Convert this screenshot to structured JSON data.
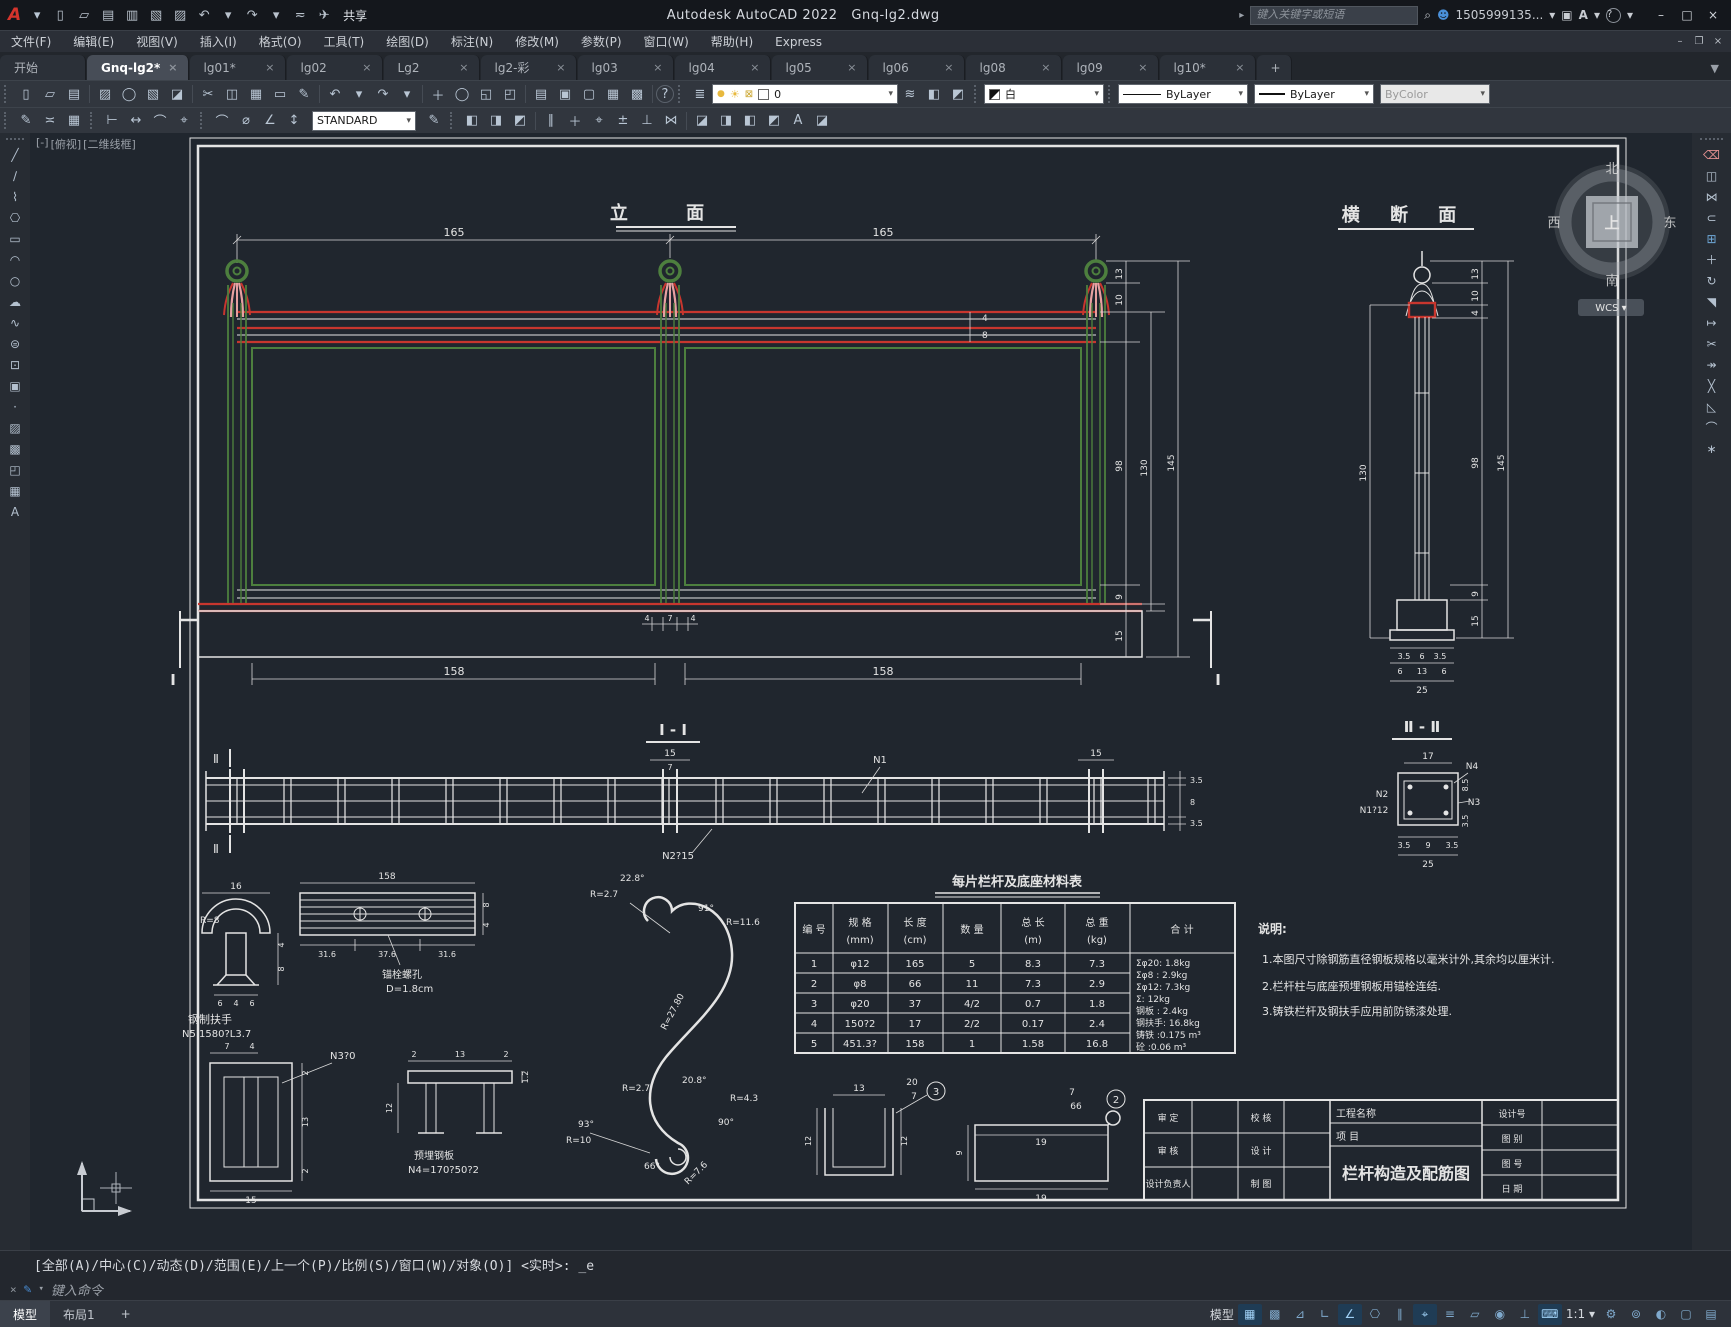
{
  "titlebar": {
    "app_title": "Autodesk AutoCAD 2022",
    "doc_title": "Gnq-lg2.dwg",
    "share_label": "共享",
    "search_placeholder": "键入关键字或短语",
    "account_label": "1505999135...",
    "quick_access_tools": [
      "new",
      "open",
      "save",
      "save-as",
      "plot",
      "print",
      "undo",
      "redo",
      "workspace-dropdown",
      "share"
    ]
  },
  "menubar": {
    "items": [
      "文件(F)",
      "编辑(E)",
      "视图(V)",
      "插入(I)",
      "格式(O)",
      "工具(T)",
      "绘图(D)",
      "标注(N)",
      "修改(M)",
      "参数(P)",
      "窗口(W)",
      "帮助(H)",
      "Express"
    ]
  },
  "file_tabs": {
    "tabs": [
      {
        "label": "开始"
      },
      {
        "label": "Gnq-lg2*"
      },
      {
        "label": "lg01*"
      },
      {
        "label": "lg02"
      },
      {
        "label": "Lg2"
      },
      {
        "label": "lg2-彩"
      },
      {
        "label": "lg03"
      },
      {
        "label": "lg04"
      },
      {
        "label": "lg05"
      },
      {
        "label": "lg06"
      },
      {
        "label": "lg08"
      },
      {
        "label": "lg09"
      },
      {
        "label": "lg10*"
      },
      {
        "label": "+"
      }
    ],
    "active_tab": "Gnq-lg2*",
    "close_glyph": "×"
  },
  "toolbars": {
    "layer_value": "0",
    "color_value": "白",
    "linetype_value": "ByLayer",
    "lineweight_value": "ByLayer",
    "plotstyle_value": "ByColor",
    "style_value": "STANDARD",
    "left_tools": [
      "line",
      "construction-line",
      "polyline",
      "polygon",
      "rectangle",
      "arc",
      "circle",
      "revision-cloud",
      "spline",
      "ellipse",
      "insert-block",
      "create-block",
      "point",
      "hatch",
      "gradient",
      "region",
      "table",
      "multiline-text"
    ],
    "right_tools": [
      "erase",
      "copy",
      "mirror",
      "offset",
      "array",
      "move",
      "rotate",
      "scale",
      "stretch",
      "trim",
      "extend",
      "break",
      "chamfer",
      "fillet",
      "explode"
    ]
  },
  "viewport": {
    "controls": [
      "[-]",
      "[俯视]",
      "[二维线框]"
    ]
  },
  "viewcube": {
    "north": "北",
    "south": "南",
    "west": "西",
    "east": "东",
    "center": "上",
    "wcs": "WCS ▾"
  },
  "drawing": {
    "elevation": {
      "title": "立  面",
      "dim_span_left": "165",
      "dim_span_right": "165",
      "dims_right": [
        "13",
        "10",
        "98",
        "9",
        "15",
        "130",
        "145"
      ],
      "dim_rail_4": "4",
      "dim_rail_8": "8",
      "dim_bottom_left": "158",
      "dim_bottom_right": "158",
      "dims_post": [
        "4",
        "7",
        "4"
      ],
      "section_mark": "Ⅰ"
    },
    "cross_section": {
      "title": "横 断 面",
      "dims_right": [
        "13",
        "10",
        "4",
        "98",
        "9",
        "15"
      ],
      "dim_130": "130",
      "dim_145": "145",
      "dims_base1": [
        "3.5",
        "6",
        "3.5"
      ],
      "dims_base2": [
        "6",
        "13",
        "6"
      ],
      "dim_25": "25"
    },
    "section_i": {
      "title": "Ⅰ - Ⅰ",
      "mark": "Ⅱ",
      "dim_15_mid": "15",
      "dim_7": "7",
      "label_n1": "N1",
      "dim_15_right": "15",
      "dims_right": [
        "3.5",
        "8",
        "3.5"
      ],
      "label_n2": "N2?15"
    },
    "section_ii": {
      "title": "Ⅱ - Ⅱ",
      "dim_17": "17",
      "label_n4": "N4",
      "label_n2": "N2",
      "label_n1": "N1?12",
      "label_n3": "N3",
      "dim_85": "8.5",
      "dim_35": "3.5",
      "dims_base": [
        "3.5",
        "9",
        "3.5"
      ],
      "dim_25": "25"
    },
    "detail_handrail": {
      "dim_16": "16",
      "label_r8": "R=8",
      "dims_bottom": [
        "6",
        "4",
        "6"
      ],
      "dims_right": [
        "4",
        "8"
      ],
      "caption1": "钢制扶手",
      "caption2": "N5 1580?L3.7"
    },
    "detail_plate": {
      "dim_158": "158",
      "dims_bottom": [
        "31.6",
        "37.6",
        "31.6"
      ],
      "dims_right": [
        "8",
        "4"
      ],
      "caption1": "锚栓螺孔",
      "caption2": "D=1.8cm"
    },
    "detail_anchor": {
      "dims_top": [
        "7",
        "4"
      ],
      "dims_right": [
        "2",
        "13",
        "2"
      ],
      "dim_bottom": "15",
      "label_n3": "N3?0",
      "caption1": "预埋钢板",
      "caption2": "N4=170?50?2"
    },
    "detail_plate_side": {
      "dims_top": [
        "2",
        "13",
        "2"
      ],
      "dim_left": "12",
      "dim_right": "1.2"
    },
    "detail_scroll": {
      "labels": [
        "R=2.7",
        "22.8°",
        "91°",
        "R=11.6",
        "R=27.80",
        "R=2.7",
        "20.8°",
        "R=4.3",
        "90°",
        "93°",
        "R=10",
        "66°",
        "R=7.6"
      ]
    },
    "detail_channel": {
      "dim_13": "13",
      "dim_20": "20",
      "dim_7": "7",
      "balloon": "3",
      "dim_left": "12",
      "dim_right": "12"
    },
    "detail_pad": {
      "dim_7": "7",
      "dim_66": "66",
      "balloon": "2",
      "dim_19_top": "19",
      "dim_9": "9",
      "dim_19_bottom": "19"
    },
    "material_table": {
      "title": "每片栏杆及底座材料表",
      "header_l1": [
        "编 号",
        "规 格",
        "长 度",
        "数 量",
        "总 长",
        "总 重",
        "合  计"
      ],
      "header_l2": [
        "",
        "(mm)",
        "(cm)",
        "",
        "(m)",
        "(kg)",
        ""
      ],
      "rows": [
        [
          "1",
          "φ12",
          "165",
          "5",
          "8.3",
          "7.3"
        ],
        [
          "2",
          "φ8",
          "66",
          "11",
          "7.3",
          "2.9"
        ],
        [
          "3",
          "φ20",
          "37",
          "4/2",
          "0.7",
          "1.8"
        ],
        [
          "4",
          "150?2",
          "17",
          "2/2",
          "0.17",
          "2.4"
        ],
        [
          "5",
          "451.3?",
          "158",
          "1",
          "1.58",
          "16.8"
        ]
      ],
      "totals": [
        "Σφ20:  1.8kg",
        "Σφ8 :  2.9kg",
        "Σφ12:  7.3kg",
        "Σ:    12kg",
        "钢板 :  2.4kg",
        "钢扶手: 16.8kg",
        "铸铁 :0.175 m³",
        "砼  :0.06 m³"
      ]
    },
    "notes": {
      "title": "说明:",
      "items": [
        "1.本图尺寸除钢筋直径钢板规格以毫米计外,其余均以厘米计.",
        "2.栏杆柱与底座预埋钢板用锚栓连结.",
        "3.铸铁栏杆及钢扶手应用前防锈漆处理."
      ]
    },
    "title_block": {
      "project_label": "工程名称",
      "item_label": "项  目",
      "drawing_title": "栏杆构造及配筋图",
      "left_rows": [
        [
          "审  定",
          "校  核"
        ],
        [
          "审  核",
          "设  计"
        ],
        [
          "设计负责人",
          "制  图"
        ]
      ],
      "right_rows": [
        "设计号",
        "图  别",
        "图  号",
        "日  期"
      ]
    }
  },
  "command_line": {
    "history": "[全部(A)/中心(C)/动态(D)/范围(E)/上一个(P)/比例(S)/窗口(W)/对象(O)] <实时>: _e",
    "prompt": "键入命令"
  },
  "status_bar": {
    "tabs": [
      "模型",
      "布局1",
      "+"
    ],
    "model_label": "模型",
    "scale_label": "1:1",
    "icons": [
      "grid",
      "snap",
      "infer-constraints",
      "ortho",
      "polar-tracking",
      "isometric-drafting",
      "object-snap-tracking",
      "object-snap",
      "lineweight",
      "transparency",
      "selection-cycling",
      "dynamic-ucs",
      "dynamic-input",
      "annotation-scale",
      "workspace-switching",
      "annotation-monitor",
      "isolate-objects",
      "clean-screen",
      "customization"
    ]
  }
}
